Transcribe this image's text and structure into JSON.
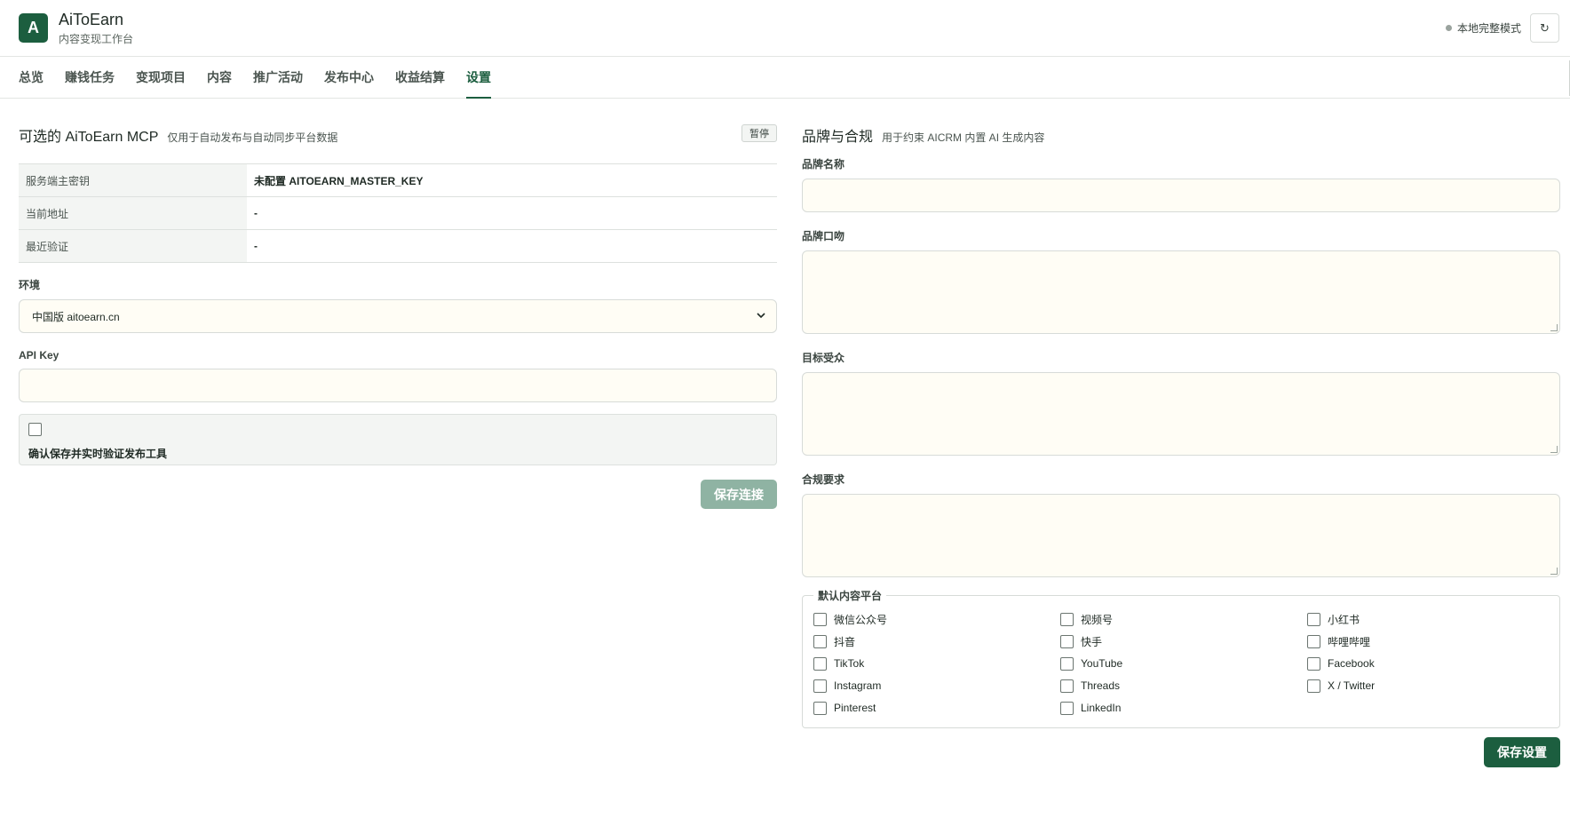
{
  "app": {
    "logo_letter": "A",
    "title": "AiToEarn",
    "subtitle": "内容变现工作台",
    "mode": "本地完整模式",
    "refresh_glyph": "↻"
  },
  "nav": {
    "items": [
      "总览",
      "赚钱任务",
      "变现项目",
      "内容",
      "推广活动",
      "发布中心",
      "收益结算",
      "设置"
    ],
    "active": "设置"
  },
  "mcp": {
    "title": "可选的 AiToEarn MCP",
    "subtitle": "仅用于自动发布与自动同步平台数据",
    "pause_label": "暂停",
    "rows": [
      {
        "key": "服务端主密钥",
        "value": "未配置 AITOEARN_MASTER_KEY"
      },
      {
        "key": "当前地址",
        "value": "-"
      },
      {
        "key": "最近验证",
        "value": "-"
      }
    ],
    "env_label": "环境",
    "env_value": "中国版 aitoearn.cn",
    "api_key_label": "API Key",
    "api_key_value": "",
    "confirm_label": "确认保存并实时验证发布工具",
    "save_label": "保存连接"
  },
  "brand": {
    "title": "品牌与合规",
    "subtitle": "用于约束 AICRM 内置 AI 生成内容",
    "name_label": "品牌名称",
    "tone_label": "品牌口吻",
    "audience_label": "目标受众",
    "compliance_label": "合规要求",
    "platforms_legend": "默认内容平台",
    "platforms": [
      "微信公众号",
      "视频号",
      "小红书",
      "抖音",
      "快手",
      "哔哩哔哩",
      "TikTok",
      "YouTube",
      "Facebook",
      "Instagram",
      "Threads",
      "X / Twitter",
      "Pinterest",
      "LinkedIn"
    ],
    "save_label": "保存设置"
  },
  "colors": {
    "accent": "#1c5e3f",
    "accent_disabled": "#8fb3a3",
    "input_bg": "#fffdf5"
  }
}
